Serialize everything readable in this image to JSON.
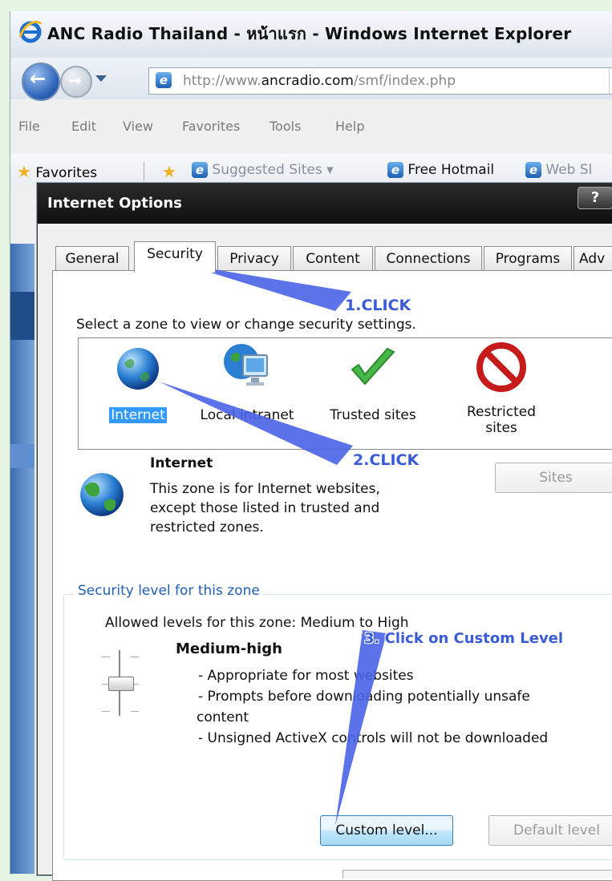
{
  "browser": {
    "title": "ANC Radio Thailand - หน้าแรก - Windows Internet Explorer",
    "url_prefix": "http://www.",
    "url_domain": "ancradio.com",
    "url_suffix": "/smf/index.php",
    "menu": [
      "File",
      "Edit",
      "View",
      "Favorites",
      "Tools",
      "Help"
    ],
    "favorites_label": "Favorites",
    "suggested_sites": "Suggested Sites ▾",
    "free_hotmail": "Free Hotmail",
    "web_slice": "Web Sl"
  },
  "dialog": {
    "title": "Internet Options",
    "help_glyph": "?",
    "tabs": [
      "General",
      "Security",
      "Privacy",
      "Content",
      "Connections",
      "Programs",
      "Adv"
    ],
    "active_tab": "Security",
    "zone_prompt": "Select a zone to view or change security settings.",
    "zones": [
      {
        "name": "Internet",
        "icon": "globe-icon"
      },
      {
        "name": "Local intranet",
        "icon": "intranet-icon"
      },
      {
        "name": "Trusted sites",
        "icon": "checkmark-icon"
      },
      {
        "name": "Restricted sites",
        "icon": "no-entry-icon",
        "line1": "Restricted",
        "line2": "sites"
      }
    ],
    "selected_zone": {
      "heading": "Internet",
      "desc1": "This zone is for Internet websites,",
      "desc2": "except those listed in trusted and",
      "desc3": "restricted zones."
    },
    "sites_button": "Sites",
    "security_group_label": "Security level for this zone",
    "allowed_levels": "Allowed levels for this zone: Medium to High",
    "level_name": "Medium-high",
    "level_details": [
      "- Appropriate for most websites",
      "- Prompts before downloading potentially unsafe",
      "content",
      "- Unsigned ActiveX controls will not be downloaded"
    ],
    "custom_level_button": "Custom level...",
    "default_level_button": "Default level"
  },
  "annotations": {
    "step1": "1.CLICK",
    "step2": "2.CLICK",
    "step3": "3. Click on Custom Level",
    "arrow_color": "#3a5bd8"
  }
}
